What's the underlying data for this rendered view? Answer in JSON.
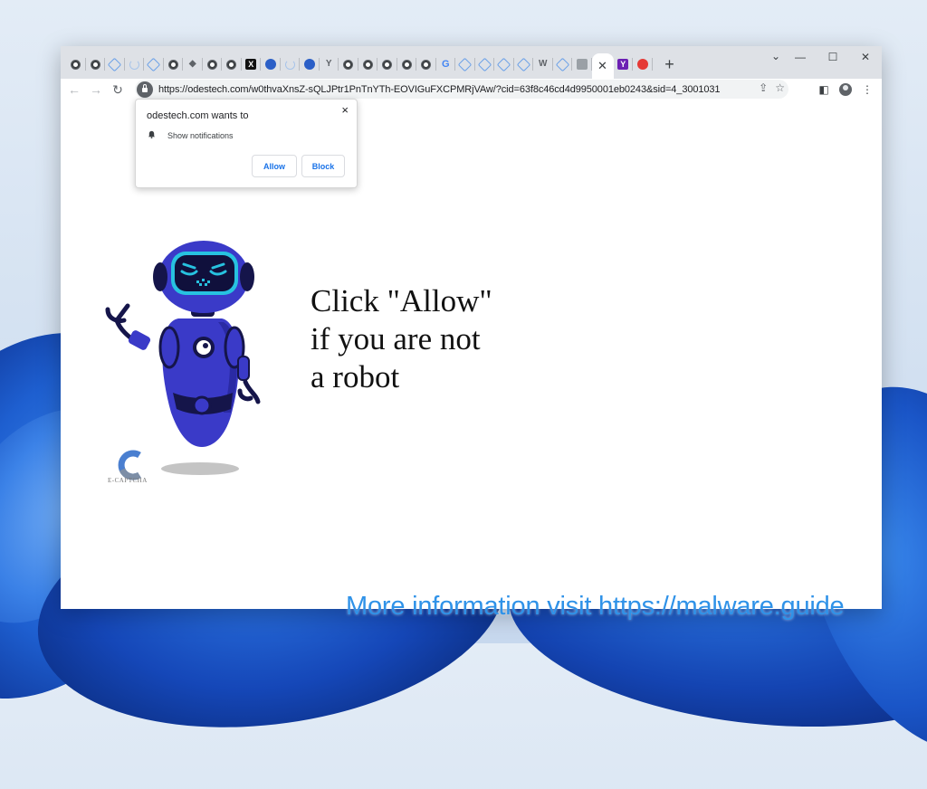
{
  "browser": {
    "tab_icons": [
      "globe-icon",
      "globe-icon",
      "outline-icon",
      "spinner-icon",
      "outline-icon",
      "globe-icon",
      "gem-icon",
      "globe-icon",
      "globe-icon",
      "x-icon",
      "blue-icon",
      "spinner-icon",
      "blue-icon",
      "y-icon",
      "globe-icon",
      "globe-icon",
      "globe-icon",
      "globe-icon",
      "globe-icon",
      "google-icon",
      "outline-icon",
      "outline-icon",
      "outline-icon",
      "outline-icon",
      "wordpress-icon",
      "outline-icon",
      "gray-icon"
    ],
    "active_tab_close": "✕",
    "after_active_icons": [
      "purple-icon",
      "red-icon"
    ],
    "new_tab_label": "+",
    "window_controls": {
      "minimize": "—",
      "maximize": "☐",
      "close": "✕"
    },
    "tab_search": "⌄",
    "nav": {
      "back": "←",
      "forward": "→",
      "reload": "↻"
    },
    "url": "https://odestech.com/w0thvaXnsZ-sQLJPtr1PnTnYTh-EOVIGuFXCPMRjVAw/?cid=63f8c46cd4d9950001eb0243&sid=4_3001031",
    "omni_icons": {
      "share": "⇪",
      "bookmark": "☆"
    },
    "toolbar_icons": {
      "sidepanel": "◧",
      "menu": "⋮"
    }
  },
  "notification_popup": {
    "title": "odestech.com wants to",
    "close": "×",
    "permission": "Show notifications",
    "allow_label": "Allow",
    "block_label": "Block"
  },
  "page": {
    "headline_lines": [
      "Click \"Allow\"",
      "if you are not",
      "a robot"
    ],
    "captcha_text": "E-CAPTCHA"
  },
  "watermark": "More information visit https://malware.guide",
  "colors": {
    "robot_body": "#3a3ac8",
    "robot_dark": "#15154a",
    "visor": "#27c2e0",
    "button_text": "#1a73e8",
    "watermark": "#2f92e8"
  }
}
